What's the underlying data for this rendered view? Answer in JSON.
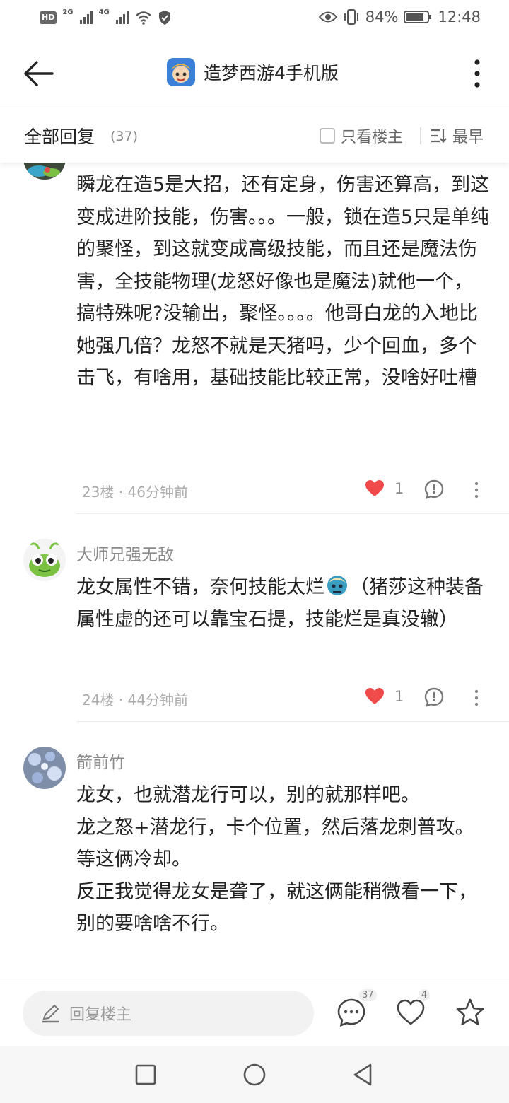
{
  "status_bar": {
    "hd_label": "HD",
    "net1": "2G",
    "net2": "4G",
    "battery": "84%",
    "time": "12:48"
  },
  "app_bar": {
    "title": "造梦西游4手机版"
  },
  "filter": {
    "all_replies": "全部回复",
    "count": "(37)",
    "owner_only": "只看楼主",
    "sort": "最早"
  },
  "posts": [
    {
      "username": "",
      "text": "瞬龙在造5是大招，还有定身，伤害还算高，到这变成进阶技能，伤害。。。一般，锁在造5只是单纯的聚怪，到这就变成高级技能，而且还是魔法伤害，全技能物理(龙怒好像也是魔法)就他一个，搞特殊呢?没输出，聚怪。。。。他哥白龙的入地比她强几倍？龙怒不就是天猪吗，少个回血，多个击飞，有啥用，基础技能比较正常，没啥好吐槽",
      "meta": "23楼 · 46分钟前",
      "likes": "1"
    },
    {
      "username": "大师兄强无敌",
      "text_before_emoji": "龙女属性不错，奈何技能太烂",
      "text_after_emoji": "（猪莎这种装备属性虚的还可以靠宝石提，技能烂是真没辙）",
      "meta": "24楼 · 44分钟前",
      "likes": "1"
    },
    {
      "username": "箭前竹",
      "lines": [
        "龙女，也就潜龙行可以，别的就那样吧。",
        "龙之怒+潜龙行，卡个位置，然后落龙刺普攻。",
        "等这俩冷却。",
        "反正我觉得龙女是聋了，就这俩能稍微看一下，别的要啥啥不行。"
      ]
    }
  ],
  "bottom_bar": {
    "reply_placeholder": "回复楼主",
    "comment_count": "37",
    "like_count": "4"
  },
  "colors": {
    "like_red": "#f04a4a",
    "meta_gray": "#aaaaaa",
    "text": "#222222"
  }
}
